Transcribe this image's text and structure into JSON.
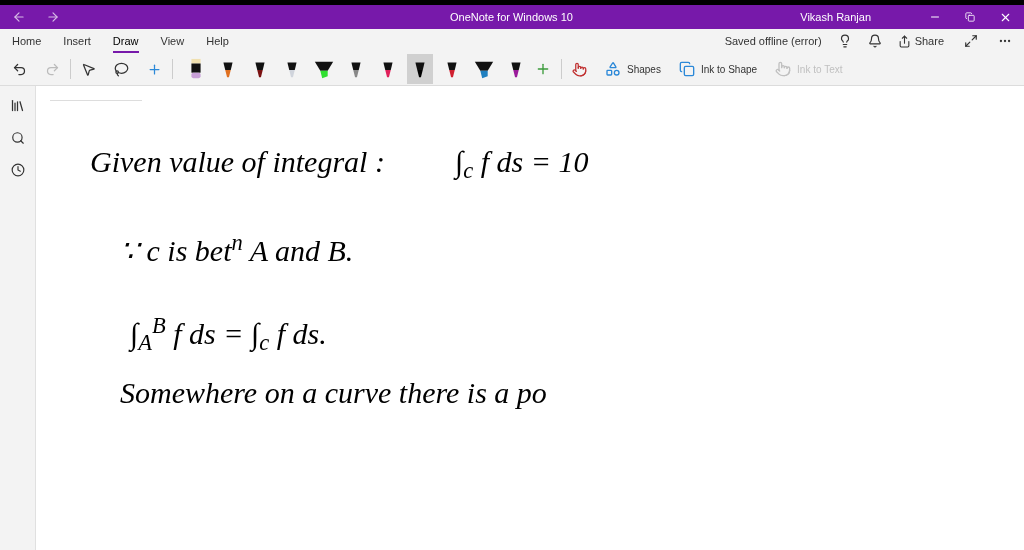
{
  "window": {
    "title": "OneNote for Windows 10",
    "user": "Vikash Ranjan"
  },
  "tabs": [
    {
      "label": "Home",
      "selected": false
    },
    {
      "label": "Insert",
      "selected": false
    },
    {
      "label": "Draw",
      "selected": true
    },
    {
      "label": "View",
      "selected": false
    },
    {
      "label": "Help",
      "selected": false
    }
  ],
  "status": "Saved offline (error)",
  "share": "Share",
  "pens": [
    {
      "kind": "eraser",
      "color": "#c8a0d8",
      "selected": false
    },
    {
      "kind": "pen",
      "color": "#e07020",
      "selected": false
    },
    {
      "kind": "pen",
      "color": "#7a1010",
      "selected": false
    },
    {
      "kind": "pen",
      "color": "#d0d4dc",
      "selected": false
    },
    {
      "kind": "highlighter",
      "color": "#30e030",
      "selected": false
    },
    {
      "kind": "pen",
      "color": "#888888",
      "selected": false
    },
    {
      "kind": "pen",
      "color": "#e0205a",
      "selected": false
    },
    {
      "kind": "pen",
      "color": "#000000",
      "selected": true
    },
    {
      "kind": "pen",
      "color": "#d02030",
      "selected": false
    },
    {
      "kind": "highlighter",
      "color": "#2080c0",
      "selected": false
    },
    {
      "kind": "pen",
      "color": "#9a1a9a",
      "selected": false
    }
  ],
  "tools": [
    {
      "label": "Shapes",
      "disabled": false
    },
    {
      "label": "Ink to Shape",
      "disabled": false
    },
    {
      "label": "Ink to Text",
      "disabled": true
    }
  ],
  "ink_lines": [
    {
      "text": "Given value of integral :",
      "formula": "∫$_{c}$ f ds = 10"
    },
    {
      "text": "∵ c is bet$^{n}$ A and B."
    },
    {
      "text": "∫$_{A}$$^{B}$ f ds = ∫$_{c}$ f ds."
    },
    {
      "text": "Somewhere on a curve there is a po"
    }
  ]
}
